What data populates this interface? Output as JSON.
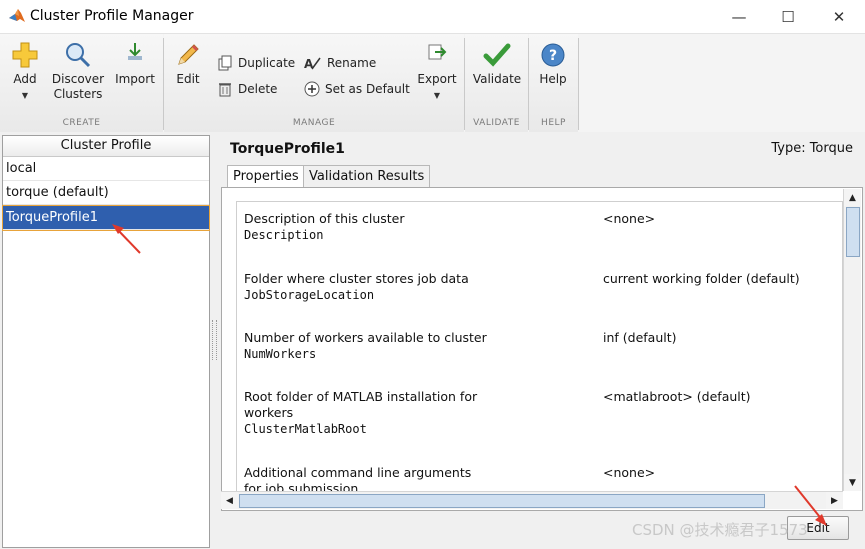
{
  "window": {
    "title": "Cluster Profile Manager",
    "minimize": "—",
    "maximize": "☐",
    "close": "✕"
  },
  "toolstrip": {
    "create": {
      "label": "CREATE",
      "add": "Add",
      "discover_line1": "Discover",
      "discover_line2": "Clusters",
      "import": "Import"
    },
    "manage": {
      "label": "MANAGE",
      "edit": "Edit",
      "duplicate": "Duplicate",
      "delete": "Delete",
      "rename": "Rename",
      "set_default": "Set as Default",
      "export": "Export"
    },
    "validate": {
      "label": "VALIDATE",
      "validate": "Validate"
    },
    "help": {
      "label": "HELP",
      "help": "Help"
    }
  },
  "profiles": {
    "header": "Cluster Profile",
    "items": [
      {
        "label": "local"
      },
      {
        "label": "torque (default)"
      },
      {
        "label": "TorqueProfile1"
      }
    ]
  },
  "detail": {
    "name": "TorqueProfile1",
    "type": "Type: Torque",
    "tabs": [
      "Properties",
      "Validation Results"
    ],
    "properties": [
      {
        "desc": "Description of this cluster",
        "key": "Description",
        "value": "<none>"
      },
      {
        "desc": "Folder where cluster stores job data",
        "key": "JobStorageLocation",
        "value": "current working folder (default)"
      },
      {
        "desc": "Number of workers available to cluster",
        "key": "NumWorkers",
        "value": "inf (default)"
      },
      {
        "desc": "Root folder of MATLAB installation for workers",
        "key": "ClusterMatlabRoot",
        "value": "<matlabroot> (default)"
      },
      {
        "desc": "Additional command line arguments for job submission",
        "key": "",
        "value": "<none>"
      }
    ],
    "edit_button": "Edit"
  },
  "watermark": "CSDN @技术瘾君子1573",
  "colors": {
    "selection": "#2f5fae",
    "annotation_arrow": "#e0392b"
  }
}
